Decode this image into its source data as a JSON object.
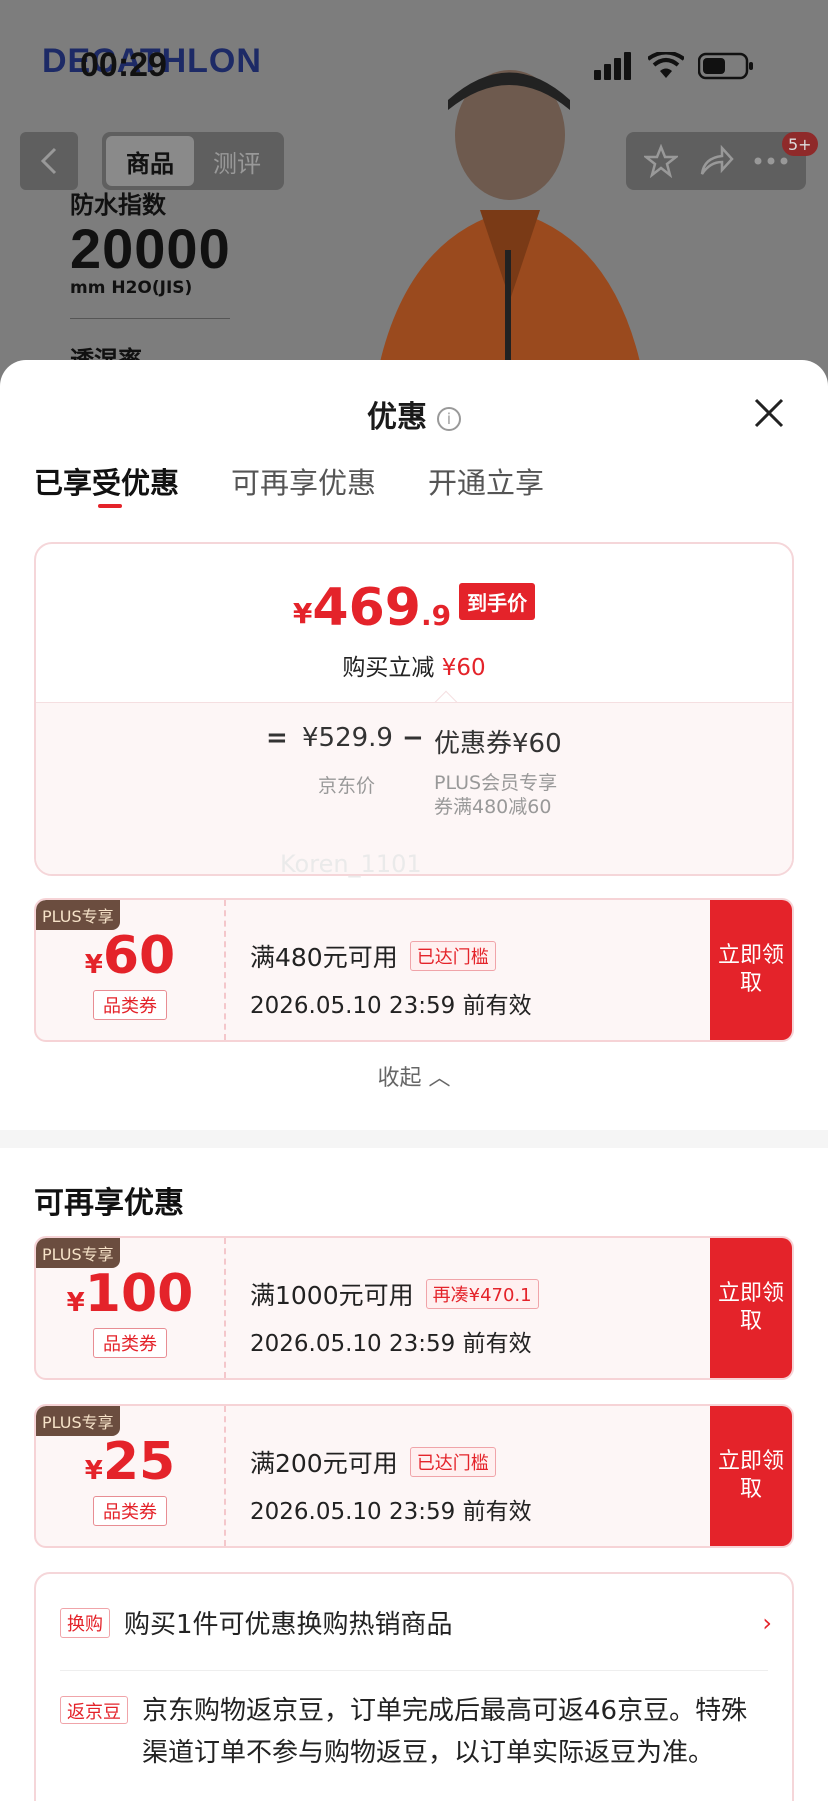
{
  "background": {
    "brand": "DECATHLON",
    "spec_label": "防水指数",
    "spec_value": "20000",
    "spec_unit": "mm H2O(JIS)",
    "spec2_label": "透湿率",
    "tabs": [
      "商品",
      "测评"
    ],
    "badge": "5+"
  },
  "status": {
    "time": "00:29"
  },
  "sheet": {
    "title": "优惠",
    "tabs": [
      "已享受优惠",
      "可再享优惠",
      "开通立享"
    ],
    "price": {
      "currency": "¥",
      "int": "469",
      "dec": ".9",
      "tag": "到手价",
      "instant_label": "购买立减",
      "instant_value": "¥60"
    },
    "breakdown": {
      "eq": "=",
      "jd_price": "¥529.9",
      "jd_label": "京东价",
      "minus": "−",
      "coupon_amount": "优惠券¥60",
      "coupon_desc": "PLUS会员专享券满480减60"
    },
    "watermark": "Koren_1101",
    "used_coupon": {
      "plus": "PLUS专享",
      "currency": "¥",
      "amount": "60",
      "category": "品类券",
      "condition": "满480元可用",
      "status": "已达门槛",
      "expiry": "2026.05.10 23:59 前有效",
      "button": "立即领取"
    },
    "collapse": "收起",
    "more_title": "可再享优惠",
    "more_coupons": [
      {
        "plus": "PLUS专享",
        "currency": "¥",
        "amount": "100",
        "category": "品类券",
        "condition": "满1000元可用",
        "status": "再凑¥470.1",
        "expiry": "2026.05.10 23:59 前有效",
        "button": "立即领取"
      },
      {
        "plus": "PLUS专享",
        "currency": "¥",
        "amount": "25",
        "category": "品类券",
        "condition": "满200元可用",
        "status": "已达门槛",
        "expiry": "2026.05.10 23:59 前有效",
        "button": "立即领取"
      }
    ],
    "exchange": {
      "tag": "换购",
      "text": "购买1件可优惠换购热销商品"
    },
    "beans": {
      "tag": "返京豆",
      "text": "京东购物返京豆，订单完成后最高可返46京豆。特殊渠道订单不参与购物返豆，以订单实际返豆为准。"
    }
  },
  "colors": {
    "accent": "#e4232a",
    "plus_bg": "#6b4d3f"
  }
}
